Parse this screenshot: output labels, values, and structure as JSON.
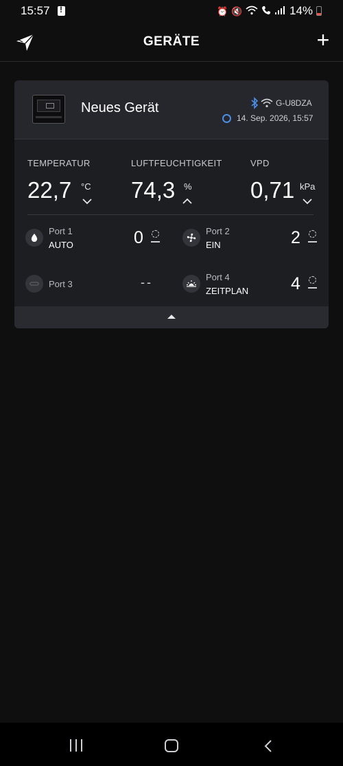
{
  "status_bar": {
    "time": "15:57",
    "battery_percent": "14%",
    "icons": [
      "alarm-icon",
      "mute-icon",
      "wifi-icon",
      "call-icon",
      "signal-icon"
    ]
  },
  "header": {
    "title": "GERÄTE",
    "add_label": "+"
  },
  "device": {
    "name": "Neues Gerät",
    "id": "G-U8DZA",
    "timestamp": "14. Sep. 2026, 15:57",
    "metrics": [
      {
        "label": "TEMPERATUR",
        "value": "22,7",
        "unit": "°C",
        "trend": "down"
      },
      {
        "label": "LUFTFEUCHTIGKEIT",
        "value": "74,3",
        "unit": "%",
        "trend": "up"
      },
      {
        "label": "VPD",
        "value": "0,71",
        "unit": "kPa",
        "trend": "down"
      }
    ],
    "ports": [
      {
        "name": "Port 1",
        "mode": "AUTO",
        "level": "0",
        "icon": "water-drop-icon"
      },
      {
        "name": "Port 2",
        "mode": "EIN",
        "level": "2",
        "icon": "fan-icon"
      },
      {
        "name": "Port 3",
        "mode": "",
        "level": "--",
        "icon": "empty-port-icon"
      },
      {
        "name": "Port 4",
        "mode": "ZEITPLAN",
        "level": "4",
        "icon": "sunrise-icon"
      }
    ]
  },
  "colors": {
    "background": "#0f0f10",
    "card": "#1d1e22",
    "card_header": "#26272c",
    "accent_blue": "#4d8fe6"
  }
}
